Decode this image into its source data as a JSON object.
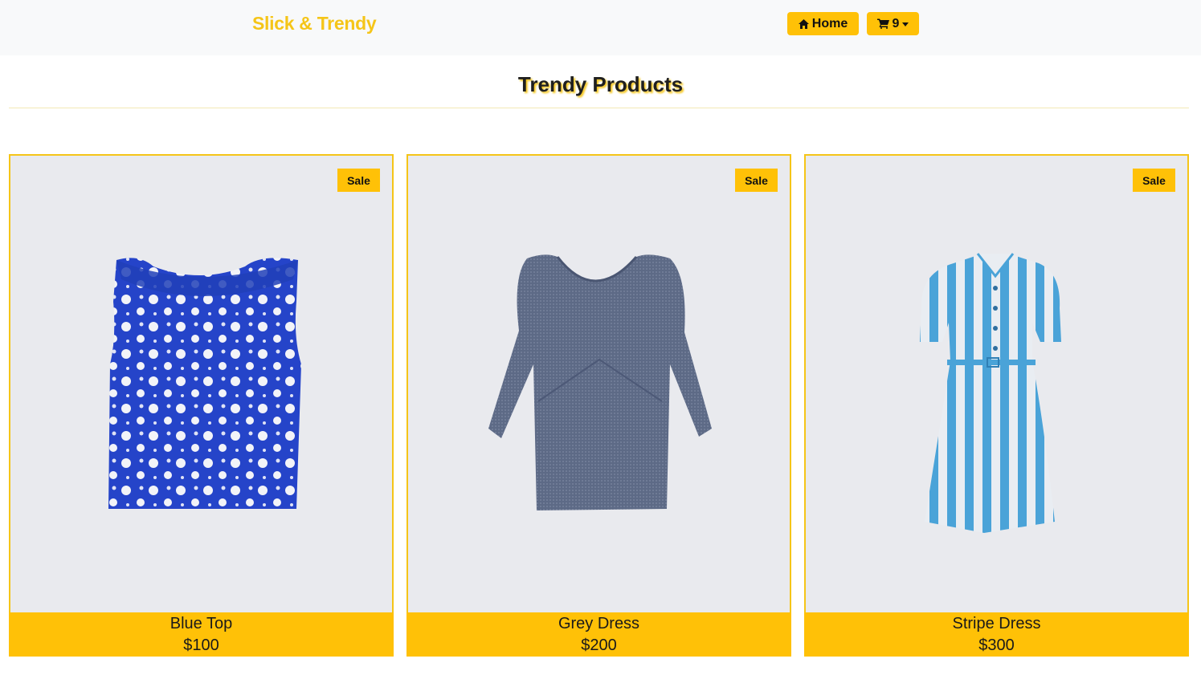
{
  "nav": {
    "brand": "Slick & Trendy",
    "home_label": "Home",
    "cart_count": "9",
    "accent_color": "#ffc107"
  },
  "page": {
    "title": "Trendy Products"
  },
  "products": [
    {
      "badge": "Sale",
      "name": "Blue Top",
      "price": "$100",
      "image": "blue floral top"
    },
    {
      "badge": "Sale",
      "name": "Grey Dress",
      "price": "$200",
      "image": "grey bell-sleeve dress"
    },
    {
      "badge": "Sale",
      "name": "Stripe Dress",
      "price": "$300",
      "image": "blue white striped shirt dress"
    }
  ]
}
